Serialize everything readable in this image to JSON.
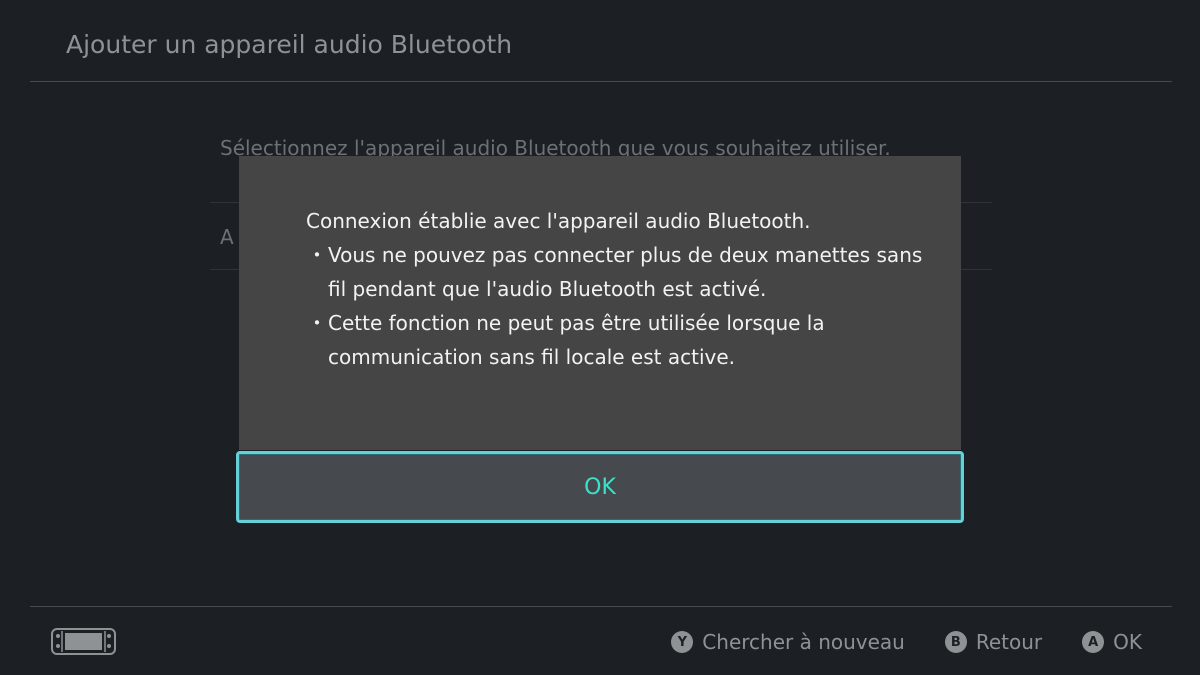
{
  "header": {
    "title": "Ajouter un appareil audio Bluetooth"
  },
  "background": {
    "instruction": "Sélectionnez l'appareil audio Bluetooth que vous souhaitez utiliser.",
    "list_item_partial": "A"
  },
  "dialog": {
    "message": "Connexion établie avec l'appareil audio Bluetooth.",
    "bullets": [
      "Vous ne pouvez pas connecter plus de deux manettes sans fil pendant que l'audio Bluetooth est activé.",
      "Cette fonction ne peut pas être utilisée lorsque la communication sans fil locale est active."
    ],
    "bullet_symbol": "・",
    "ok_label": "OK"
  },
  "footer": {
    "console_icon": "console-handheld-icon",
    "actions": [
      {
        "button": "Y",
        "label": "Chercher à nouveau"
      },
      {
        "button": "B",
        "label": "Retour"
      },
      {
        "button": "A",
        "label": "OK"
      }
    ]
  },
  "colors": {
    "background": "#1c2024",
    "dialog": "#454545",
    "focus_border": "#66d0d8",
    "ok_text": "#3fe0c8"
  }
}
